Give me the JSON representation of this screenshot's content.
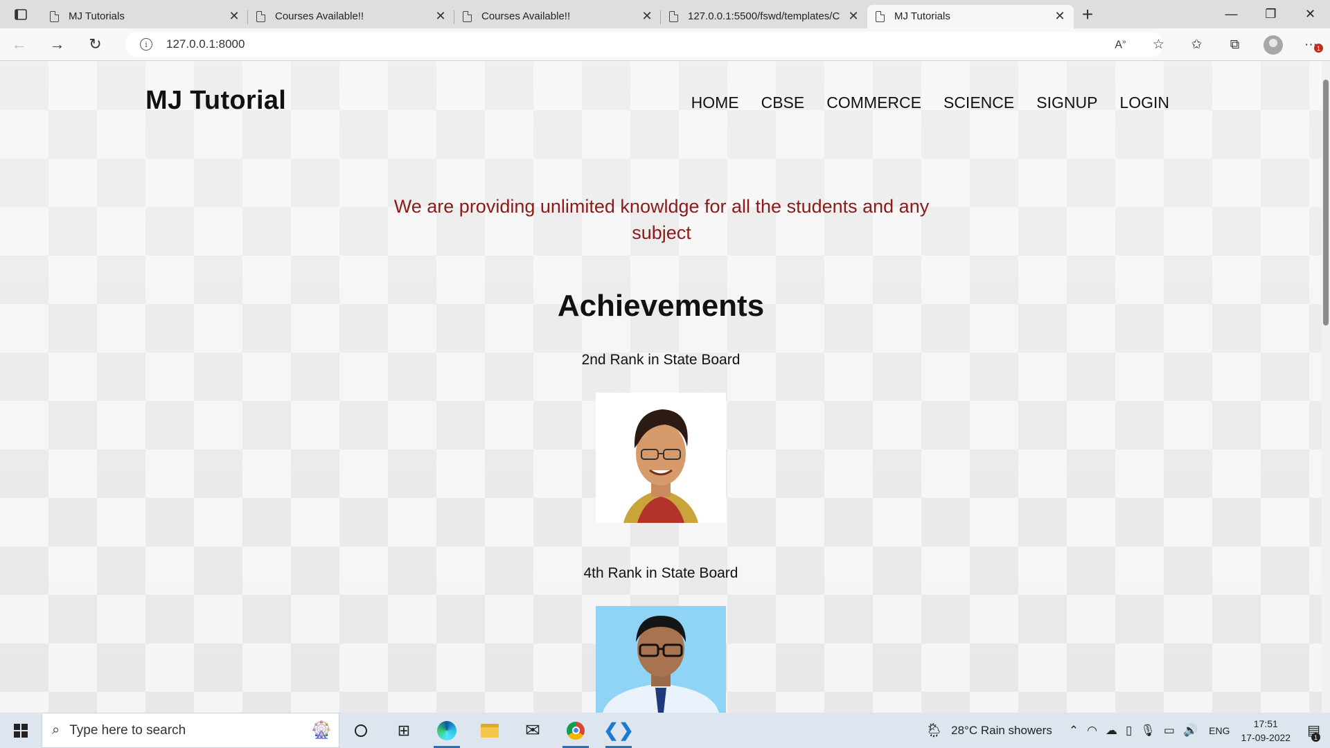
{
  "browser": {
    "tabs": [
      {
        "title": "MJ Tutorials",
        "active": false
      },
      {
        "title": "Courses Available!!",
        "active": false
      },
      {
        "title": "Courses Available!!",
        "active": false
      },
      {
        "title": "127.0.0.1:5500/fswd/templates/C",
        "active": false
      },
      {
        "title": "MJ Tutorials",
        "active": true
      }
    ],
    "url": "127.0.0.1:8000",
    "icons": {
      "back": "arrow-left-icon",
      "forward": "arrow-right-icon",
      "refresh": "refresh-icon",
      "info": "info-icon",
      "read_aloud": "read-aloud-icon",
      "favorite": "star-add-icon",
      "favorites": "favorites-list-icon",
      "collections": "collections-icon",
      "profile": "avatar-icon",
      "menu": "more-menu-icon"
    },
    "notification_count": "1"
  },
  "site": {
    "brand": "MJ Tutorial",
    "nav": [
      "HOME",
      "CBSE",
      "COMMERCE",
      "SCIENCE",
      "SIGNUP",
      "LOGIN"
    ],
    "tagline": "We are providing unlimited knowldge for all the students and any subject",
    "achievements_title": "Achievements",
    "achievements": [
      {
        "caption": "2nd Rank in State Board"
      },
      {
        "caption": "4th Rank in State Board"
      }
    ]
  },
  "taskbar": {
    "search_placeholder": "Type here to search",
    "weather": "28°C  Rain showers",
    "language": "ENG",
    "time": "17:51",
    "date": "17-09-2022",
    "notification_count": "1"
  },
  "colors": {
    "tagline": "#8b1a1a",
    "accent": "#2a6fbf"
  }
}
